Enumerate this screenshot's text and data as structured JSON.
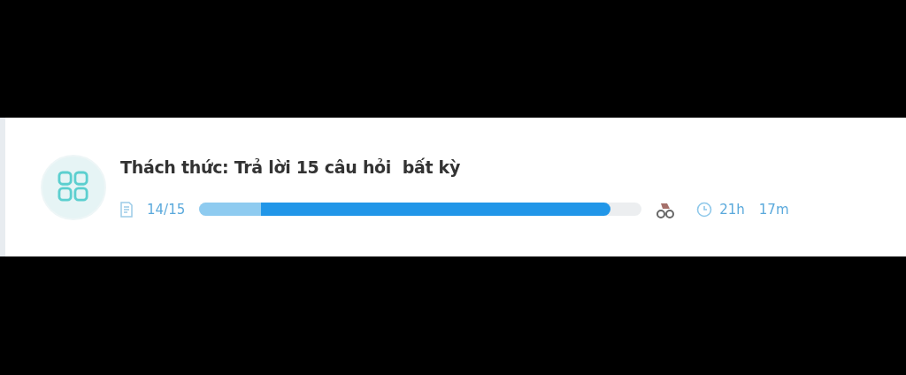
{
  "challenge": {
    "title": "Thách thức: Trả lời 15 câu hỏi  bất kỳ",
    "count": "14/15",
    "progress": {
      "level": 0.93
    },
    "time_hours": "21h",
    "time_minutes": "17m"
  }
}
